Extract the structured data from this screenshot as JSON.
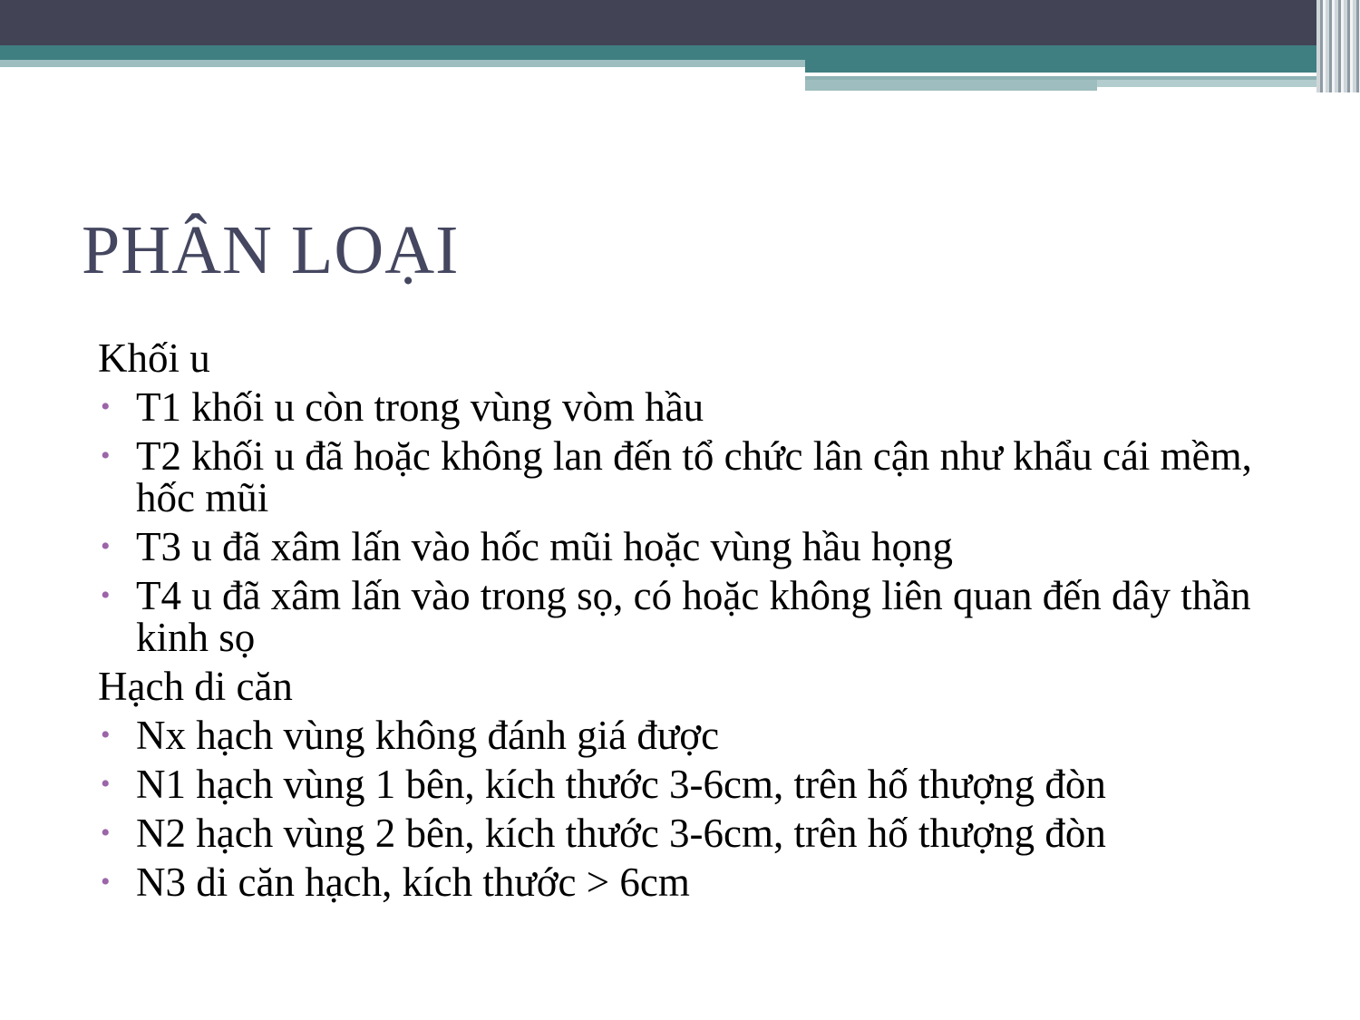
{
  "slide": {
    "title": "PHÂN LOẠI",
    "sections": [
      {
        "heading": "Khối u",
        "items": [
          "T1 khối u còn trong vùng vòm hầu",
          "T2 khối u đã hoặc không lan đến tổ chức lân cận như khẩu cái mềm, hốc mũi",
          "T3 u đã xâm lấn vào hốc mũi hoặc vùng hầu họng",
          "T4 u đã xâm lấn vào trong sọ, có hoặc không liên quan đến dây thần kinh sọ"
        ]
      },
      {
        "heading": "Hạch di căn",
        "items": [
          "Nx hạch vùng không đánh giá được",
          "N1 hạch vùng 1 bên, kích thước 3-6cm, trên hố thượng đòn",
          "N2 hạch vùng 2 bên, kích thước 3-6cm, trên hố thượng đòn",
          "N3 di căn hạch, kích thước > 6cm"
        ]
      }
    ],
    "bullet_symbol": "•"
  },
  "colors": {
    "title": "#454760",
    "bullet": "#9b65a8",
    "header_dark": "#434356",
    "header_teal": "#3f7f82",
    "header_light": "#9dbdbe"
  }
}
